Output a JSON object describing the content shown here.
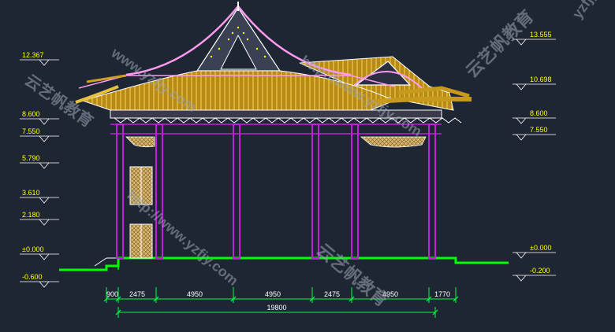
{
  "elevations_left": [
    "12.367",
    "8.600",
    "7.550",
    "5.790",
    "3.610",
    "2.180",
    "±0.000",
    "-0.600"
  ],
  "elevations_right": [
    "13.555",
    "10.698",
    "8.600",
    "7.550",
    "±0.000",
    "-0.200"
  ],
  "dimensions": [
    "900",
    "2475",
    "4950",
    "4950",
    "2475",
    "4950",
    "1770"
  ],
  "dimension_total": "19800",
  "watermarks": [
    "www.yzfjy.com",
    "云艺帆教育",
    "http://www.yzfjy.com",
    "yzfjy",
    "云艺帆教育",
    "http://www.yzfjy.com",
    "云艺帆教育"
  ],
  "colors": {
    "background": "#1e2634",
    "level_text": "#ffff00",
    "ground": "#00ff00",
    "columns": "#c020d8",
    "roof_tiles": "#c89a1c",
    "outline": "#ffffff",
    "dimension": "#00ff44",
    "watermark": "#9aa5b4"
  }
}
